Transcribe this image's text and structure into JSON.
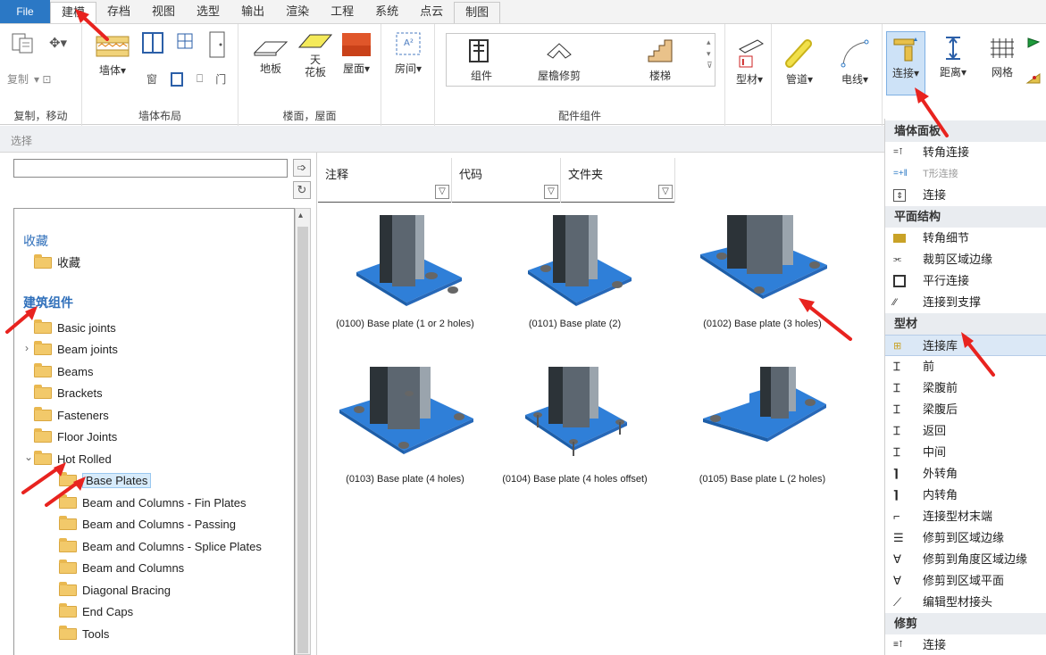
{
  "tabs": [
    "File",
    "建模",
    "存档",
    "视图",
    "选型",
    "输出",
    "渲染",
    "工程",
    "系统",
    "点云",
    "制图"
  ],
  "active_tab": "建模",
  "ribbon": {
    "copy_group": {
      "copy": "复制",
      "label": "复制，移动"
    },
    "wall_group": {
      "wall": "墙体",
      "window": "窗",
      "door": "门",
      "label": "墙体布局"
    },
    "floor_group": {
      "floor": "地板",
      "ceiling": "天\n花板",
      "roof": "屋面",
      "label": "楼面，屋面"
    },
    "room_group": {
      "room": "房间"
    },
    "component_group": {
      "component": "组件",
      "eave_trim": "屋檐修剪",
      "stairs": "楼梯",
      "label": "配件组件"
    },
    "profile": "型材",
    "pipe": "管道",
    "cable": "电线",
    "connect": "连接",
    "distance": "距离",
    "grid": "网格"
  },
  "select_bar": "选择",
  "search": {
    "placeholder": ""
  },
  "tree": {
    "favorites_head": "收藏",
    "favorites_item": "收藏",
    "building_head": "建筑组件",
    "items": [
      "Basic joints",
      "Beam joints",
      "Beams",
      "Brackets",
      "Fasteners",
      "Floor Joints",
      "Hot Rolled",
      "Base Plates",
      "Beam and Columns - Fin Plates",
      "Beam and Columns - Passing",
      "Beam and Columns - Splice Plates",
      "Beam and Columns",
      "Diagonal Bracing",
      "End Caps",
      "Tools"
    ]
  },
  "columns": {
    "note": "注释",
    "code": "代码",
    "folder": "文件夹"
  },
  "tiles": [
    "(0100) Base plate (1 or 2 holes)",
    "(0101) Base plate (2)",
    "(0102) Base plate (3 holes)",
    "(0103) Base plate (4 holes)",
    "(0104) Base plate (4 holes offset)",
    "(0105) Base plate L (2 holes)"
  ],
  "menu": {
    "sec_wall": "墙体面板",
    "corner_conn": "转角连接",
    "t_conn": "T形连接",
    "conn": "连接",
    "sec_plane": "平面结构",
    "corner_detail": "转角细节",
    "trim_edge": "裁剪区域边缘",
    "parallel_conn": "平行连接",
    "conn_support": "连接到支撑",
    "sec_profile": "型材",
    "conn_lib": "连接库",
    "front": "前",
    "web_front": "梁腹前",
    "web_back": "梁腹后",
    "back": "返回",
    "middle": "中间",
    "outer_corner": "外转角",
    "inner_corner": "内转角",
    "conn_profile_end": "连接型材末端",
    "trim_area_edge": "修剪到区域边缘",
    "trim_angle_edge": "修剪到角度区域边缘",
    "trim_area_plane": "修剪到区域平面",
    "edit_profile_joint": "编辑型材接头",
    "sec_trim": "修剪",
    "trim_conn": "连接"
  },
  "colors": {
    "accent": "#2b78c5",
    "plate": "#2f7fd8",
    "arrow": "#e8231f"
  }
}
